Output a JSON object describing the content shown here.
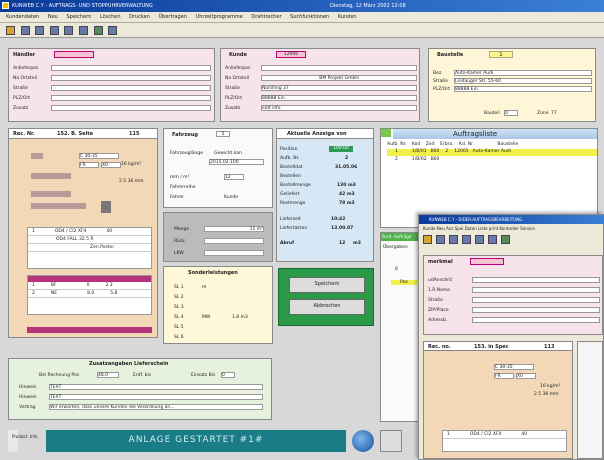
{
  "window": {
    "title": "KUNWEB C.Y - AUFTRAGS- UND STOPPUHRVERWALTUNG",
    "title_right": "Dienstag, 12 März 2002 12:08"
  },
  "menu": [
    "Kundendaten",
    "Neu",
    "Speichern",
    "Löschen",
    "Drucken",
    "Übertragen",
    "Uhrzeitprogramme",
    "Drahtrecher",
    "Suchfunktionen",
    "Kunden"
  ],
  "haendler": {
    "title": "Händler",
    "labels": [
      "Anlieferpos",
      "Na Ortsteil",
      "Straße",
      "PLZ/Ort",
      "Zusatz"
    ]
  },
  "kunde": {
    "title": "Kunde",
    "code": "12006",
    "labels": [
      "Anlieferpos",
      "Na Ortsteil",
      "Straße",
      "PLZ/Ort",
      "Zusatz"
    ],
    "values": [
      "",
      "BM Projekt GmbH",
      "Nordring 37",
      "88888  Ein",
      "edit info"
    ]
  },
  "baustelle": {
    "title": "Baustelle",
    "code": "1",
    "labels": [
      "Bez.",
      "Straße",
      "PLZ/Ort"
    ],
    "values": [
      "Auto-Kamer Audi",
      "Lindauger Str. 55-60",
      "88888  Ein"
    ],
    "bauteil_label": "Bauteil",
    "bauteil_value": "0",
    "zone_label": "Zone",
    "zone_value": "77"
  },
  "rec": {
    "header": [
      "Rec. Nr.",
      "152. B. Seite",
      "115"
    ],
    "vals": [
      "C 30-35",
      "FR",
      "X0",
      "16 kg/m³",
      "2.5 36 mm",
      "1",
      "OD4 / CI2 XF4",
      "40",
      "OD4 FALL 32.5 R",
      "Zen.Poster",
      "1",
      "BF",
      "0",
      "2.3",
      "2",
      "NE",
      "8.0",
      "5.8"
    ]
  },
  "fahrzeug": {
    "title": "Fahrzeug",
    "no": "5",
    "labels": [
      "Fahrzeuglänge",
      "mm / m³",
      "Fahrerreihe",
      "Fahrer"
    ],
    "values": [
      "Gewicht kan",
      "2015.02.100",
      "12",
      "Kunde"
    ]
  },
  "menge": {
    "labels": [
      "Menge",
      "Rück",
      "LKW"
    ],
    "values": [
      "11 m³",
      "",
      ""
    ]
  },
  "sonder": {
    "title": "Sonderleistungen",
    "labels": [
      "SL 1",
      "SL 2",
      "SL 3",
      "SL 4",
      "SL 5",
      "SL 6"
    ],
    "values": [
      "m",
      "",
      "",
      "MW",
      "",
      "",
      "1.8 m3"
    ]
  },
  "anzeige": {
    "title": "Aktuelle Anzeige von",
    "labels": [
      "Position",
      "Aufb. Nr.",
      "Bestelldat",
      "Bestellen",
      "Bestellmenge",
      "Geliefert",
      "Restmenge",
      "Lieferzeit",
      "Liefertakten",
      "Abruf"
    ],
    "values": [
      "100.00",
      "2",
      "31.05.06",
      "",
      "130 m3",
      "42 m3",
      "78 m3",
      "10:42",
      "13.00.07",
      "12",
      "m3"
    ]
  },
  "actions": {
    "save": "Speichern",
    "cancel": "Abbrechen"
  },
  "auftrag": {
    "title": "Auftragsliste",
    "cols": [
      "Aufb. Nr.",
      "Kod",
      "Zeit",
      "Erbra.",
      "Kd. Nr.",
      "Baustelle"
    ],
    "rows": [
      [
        "1",
        "1/B/01",
        "B60",
        "2",
        "12005",
        "Auto-Kamer Audi"
      ],
      [
        "2",
        "1/B/02",
        "B60",
        "",
        "",
        ""
      ]
    ]
  },
  "pos": {
    "title": "Posit. Aufträge",
    "tab": "Übergaben",
    "val": "6",
    "col": "Pos"
  },
  "zusatz": {
    "title": "Zusatzangaben Lieferschein",
    "labels": [
      "Bei Rechnung Pos",
      "Erdf. bis",
      "Einsatz Bis",
      "Hinweis",
      "Hinweis",
      "Vertrag"
    ],
    "values": [
      "48.0",
      "",
      "0",
      "TEXT",
      "TEXT",
      "Wir erwarten, dass unsere Kunden die Verordnung an..."
    ]
  },
  "status": {
    "label": "Produkt. Info",
    "text": "ANLAGE GESTARTET #1#"
  },
  "second": {
    "title": "KUNWEB C.Y - DIDER-AUFTRAGSBEARBEITUNG",
    "menu": [
      "Kunde",
      "Neu",
      "Anz",
      "Spei",
      "Daten",
      "Liste",
      "print",
      "Kontroller",
      "Service",
      "grc"
    ],
    "merkmal": "merkmal",
    "labels": [
      "udAnschrit",
      "1.R.Name",
      "Straße",
      "ZIP/Place",
      "Adressb."
    ],
    "rec_header": [
      "Rec. no.",
      "153. in Spec",
      "113"
    ],
    "rec_vals": [
      "C 30-35",
      "FR",
      "X0",
      "16 kg/m³",
      "2.5 36 mm",
      "1",
      "OD4 / CI2 XF4",
      "40"
    ]
  }
}
